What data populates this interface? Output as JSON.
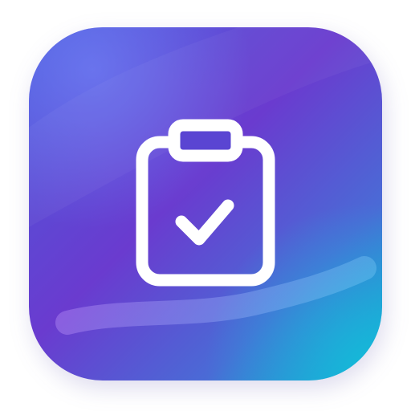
{
  "icon": {
    "name": "clipboard-check-app-icon",
    "glyph": "clipboard-check-icon",
    "colors": {
      "gradient_start": "#4a56d8",
      "gradient_mid": "#6b3bce",
      "gradient_end": "#14a9d6",
      "glyph": "#ffffff",
      "swoosh": "#c9a6ff"
    }
  }
}
